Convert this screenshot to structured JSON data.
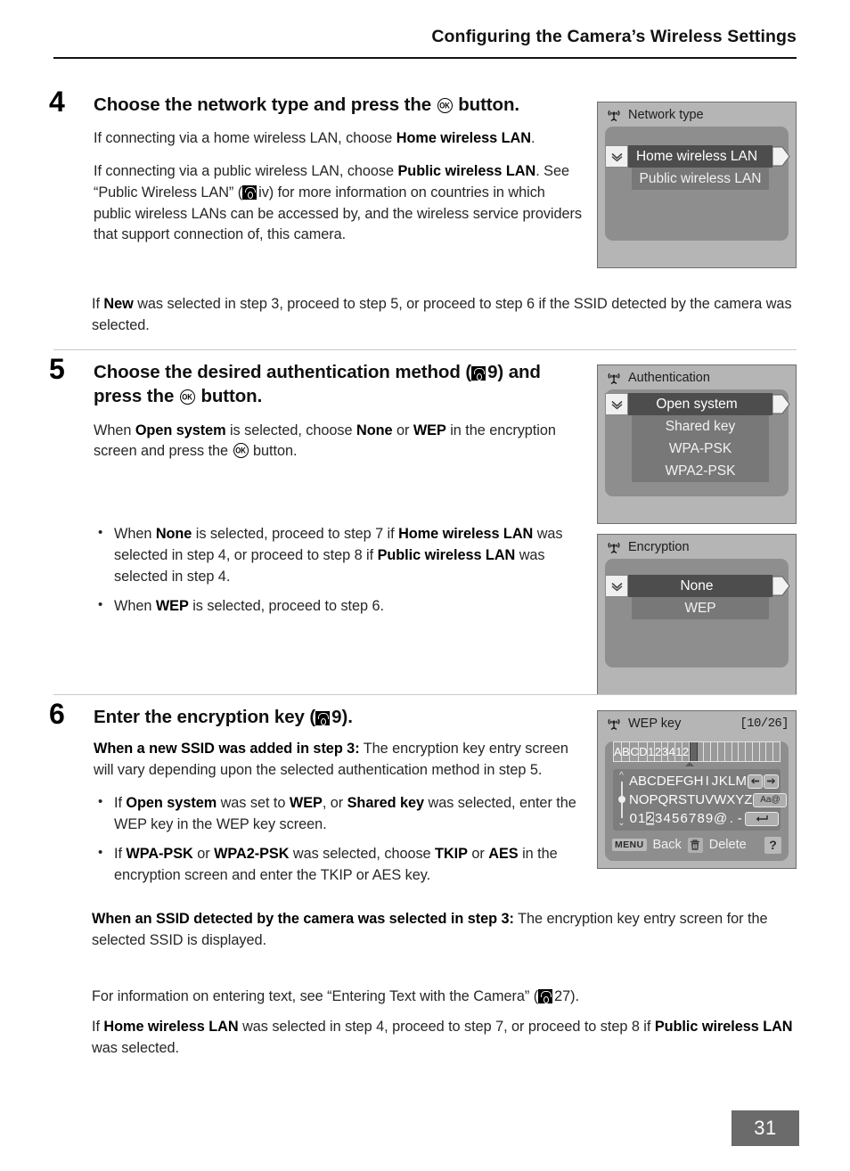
{
  "header": {
    "title": "Configuring the Camera’s Wireless Settings"
  },
  "steps": {
    "four": {
      "number": "4",
      "title_a": "Choose the network type and press the ",
      "title_b": " button.",
      "p1_a": "If connecting via a home wireless LAN, choose ",
      "p1_b": "Home wireless LAN",
      "p1_c": ".",
      "p2_a": "If connecting via a public wireless LAN, choose ",
      "p2_b": "Public wireless LAN",
      "p2_c": ". See “Public Wireless LAN” (",
      "p2_ref": "iv",
      "p2_d": ") for more information on countries in which public wireless LANs can be accessed by, and the wireless service providers that support connection of, this camera.",
      "p3_a": "If ",
      "p3_b": "New",
      "p3_c": " was selected in step 3, proceed to step 5, or proceed to step 6 if the SSID detected by the camera was selected."
    },
    "five": {
      "number": "5",
      "title_a": "Choose the desired authentication method (",
      "title_ref": "9",
      "title_b": ") and press the ",
      "title_c": " button.",
      "p1_a": "When ",
      "p1_b": "Open system",
      "p1_c": " is selected, choose ",
      "p1_d": "None",
      "p1_e": " or ",
      "p1_f": "WEP",
      "p1_g": " in the encryption screen and press the ",
      "p1_h": " button.",
      "b1_a": "When ",
      "b1_b": "None",
      "b1_c": " is selected, proceed to step 7 if ",
      "b1_d": "Home wireless LAN",
      "b1_e": " was selected in step 4, or proceed to step 8 if ",
      "b1_f": "Public wireless LAN",
      "b1_g": " was selected in step 4.",
      "b2_a": "When ",
      "b2_b": "WEP",
      "b2_c": " is selected, proceed to step 6."
    },
    "six": {
      "number": "6",
      "title_a": "Enter the encryption key (",
      "title_ref": "9",
      "title_b": ").",
      "p1_bold": "When a new SSID was added in step 3:",
      "p1_rest": " The encryption key entry screen will vary depending upon the selected authentication method in step 5.",
      "b1_a": "If ",
      "b1_b": "Open system",
      "b1_c": " was set to ",
      "b1_d": "WEP",
      "b1_e": ", or ",
      "b1_f": "Shared key",
      "b1_g": " was selected, enter the WEP key in the WEP key screen.",
      "b2_a": "If ",
      "b2_b": "WPA-PSK",
      "b2_c": " or ",
      "b2_d": "WPA2-PSK",
      "b2_e": " was selected, choose ",
      "b2_f": "TKIP",
      "b2_g": " or ",
      "b2_h": "AES",
      "b2_i": " in the encryption screen and enter the TKIP or AES key.",
      "p2_bold": "When an SSID detected by the camera was selected in step 3:",
      "p2_rest": " The encryption key entry screen for the selected SSID is displayed.",
      "p3_a": "For information on entering text, see “Entering Text with the Camera” (",
      "p3_ref": "27",
      "p3_b": ").",
      "p4_a": "If ",
      "p4_b": "Home wireless LAN",
      "p4_c": " was selected in step 4, proceed to step 7, or proceed to step 8 if ",
      "p4_d": "Public wireless LAN",
      "p4_e": " was selected."
    }
  },
  "screens": {
    "network_type": {
      "title": "Network type",
      "icon": "wireless-antenna-icon",
      "items": [
        {
          "label": "Home wireless LAN",
          "selected": true
        },
        {
          "label": "Public wireless LAN",
          "selected": false
        }
      ]
    },
    "authentication": {
      "title": "Authentication",
      "icon": "wireless-antenna-icon",
      "items": [
        {
          "label": "Open system",
          "selected": true
        },
        {
          "label": "Shared key",
          "selected": false
        },
        {
          "label": "WPA-PSK",
          "selected": false
        },
        {
          "label": "WPA2-PSK",
          "selected": false
        }
      ]
    },
    "encryption": {
      "title": "Encryption",
      "icon": "wireless-antenna-icon",
      "items": [
        {
          "label": "None",
          "selected": true
        },
        {
          "label": "WEP",
          "selected": false
        }
      ]
    },
    "wep_key": {
      "title": "WEP key",
      "icon": "wireless-antenna-icon",
      "counter": "[10/26]",
      "entered_text": "ABCD123412",
      "total_cells": 23,
      "cursor_index": 10,
      "keyboard": {
        "row1": [
          "A",
          "B",
          "C",
          "D",
          "E",
          "F",
          "G",
          "H",
          "I",
          "J",
          "K",
          "L",
          "M"
        ],
        "row2": [
          "N",
          "O",
          "P",
          "Q",
          "R",
          "S",
          "T",
          "U",
          "V",
          "W",
          "X",
          "Y",
          "Z"
        ],
        "row3": [
          "0",
          "1",
          "2",
          "3",
          "4",
          "5",
          "6",
          "7",
          "8",
          "9",
          "@",
          ".",
          "-"
        ],
        "highlighted": "2",
        "case_button": "Aa@",
        "left_arrow_button": "cursor-left-icon",
        "right_arrow_button": "cursor-right-icon",
        "enter_button": "enter-key-icon"
      },
      "footer": {
        "menu_chip": "MENU",
        "back_label": "Back",
        "delete_icon": "trash-icon",
        "delete_label": "Delete",
        "help_label": "?"
      }
    }
  },
  "footer": {
    "page_number": "31"
  },
  "colors": {
    "lcd_body": "#b5b5b5",
    "lcd_panel": "#8e8e8e",
    "row_unselected": "#787878",
    "row_selected": "#4d4d4d",
    "page_badge": "#6b6b6b"
  }
}
